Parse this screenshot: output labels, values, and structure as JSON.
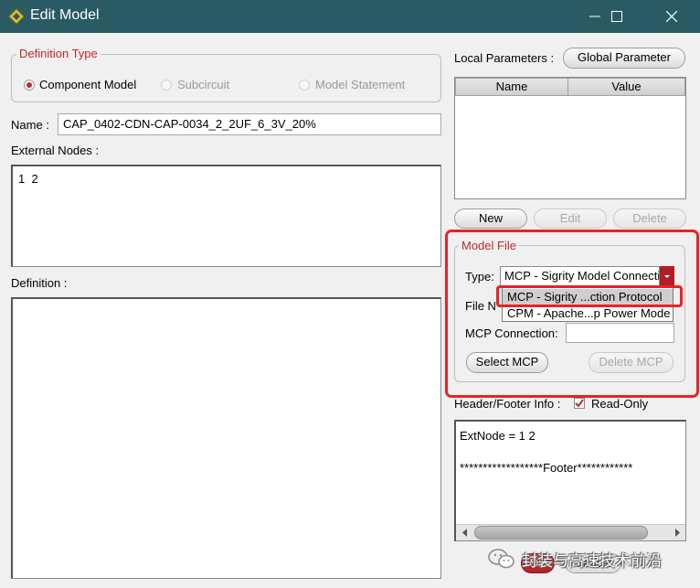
{
  "window": {
    "title": "Edit Model"
  },
  "definition_type": {
    "legend": "Definition Type",
    "options": [
      {
        "label": "Component Model",
        "selected": true
      },
      {
        "label": "Subcircuit",
        "selected": false
      },
      {
        "label": "Model Statement",
        "selected": false
      }
    ]
  },
  "name": {
    "label": "Name :",
    "value": "CAP_0402-CDN-CAP-0034_2_2UF_6_3V_20%"
  },
  "external_nodes": {
    "label": "External Nodes :",
    "value": "1  2"
  },
  "definition": {
    "label": "Definition :",
    "value": ""
  },
  "local_parameters": {
    "label": "Local Parameters :",
    "global_button": "Global Parameter",
    "columns": [
      "Name",
      "Value"
    ],
    "new_button": "New",
    "edit_button": "Edit",
    "delete_button": "Delete"
  },
  "model_file": {
    "legend": "Model File",
    "type_label": "Type:",
    "type_value": "MCP - Sigrity Model Connection Protocol",
    "dropdown_options": [
      "MCP - Sigrity ...ction Protocol",
      "CPM - Apache...p Power Mode"
    ],
    "file_label": "File N",
    "mcp_connection_label": "MCP Connection:",
    "mcp_connection_value": "",
    "select_button": "Select MCP",
    "delete_button": "Delete MCP"
  },
  "header_footer": {
    "label": "Header/Footer Info :",
    "readonly_label": "Read-Only",
    "readonly_checked": true,
    "line1": "ExtNode = 1 2",
    "line2": "******************Footer************"
  },
  "dialog_buttons": {
    "ok": "OK",
    "cancel": "Cancel"
  },
  "watermark": {
    "text": "封装与高速技术前沿"
  },
  "colors": {
    "titlebar": "#2a5b64",
    "accent": "#c0272d",
    "highlight": "#ea2127"
  }
}
